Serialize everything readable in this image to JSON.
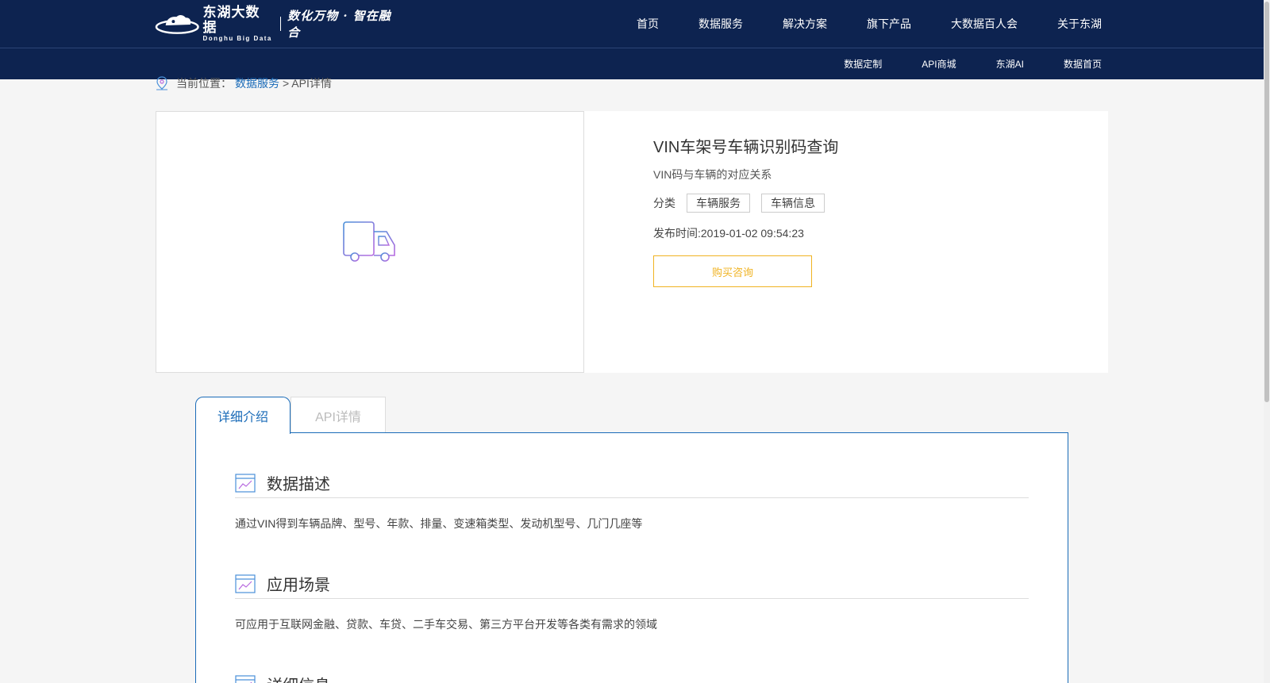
{
  "header": {
    "logo": {
      "name_cn": "东湖大数据",
      "name_en": "Donghu Big Data",
      "slogan": "数化万物 · 智在融合"
    },
    "main_nav": [
      "首页",
      "数据服务",
      "解决方案",
      "旗下产品",
      "大数据百人会",
      "关于东湖"
    ],
    "sub_nav": [
      "数据定制",
      "API商城",
      "东湖AI",
      "数据首页"
    ]
  },
  "breadcrumb": {
    "label": "当前位置：",
    "link": "数据服务",
    "current": "> API详情"
  },
  "product": {
    "title": "VIN车架号车辆识别码查询",
    "subtitle": "VIN码与车辆的对应关系",
    "category_label": "分类",
    "tags": [
      "车辆服务",
      "车辆信息"
    ],
    "publish_time": "发布时间:2019-01-02 09:54:23",
    "buy_button": "购买咨询",
    "thumbnail_icon": "truck-icon"
  },
  "tabs": [
    {
      "label": "详细介绍",
      "active": true
    },
    {
      "label": "API详情",
      "active": false
    }
  ],
  "sections": [
    {
      "title": "数据描述",
      "body": "通过VIN得到车辆品牌、型号、年款、排量、变速箱类型、发动机型号、几门几座等"
    },
    {
      "title": "应用场景",
      "body": "可应用于互联网金融、贷款、车贷、二手车交易、第三方平台开发等各类有需求的领域"
    },
    {
      "title": "详细信息",
      "body": ""
    }
  ],
  "colors": {
    "header_bg": "#0d2350",
    "link_blue": "#1a6bb8",
    "accent_orange": "#f0b322"
  }
}
